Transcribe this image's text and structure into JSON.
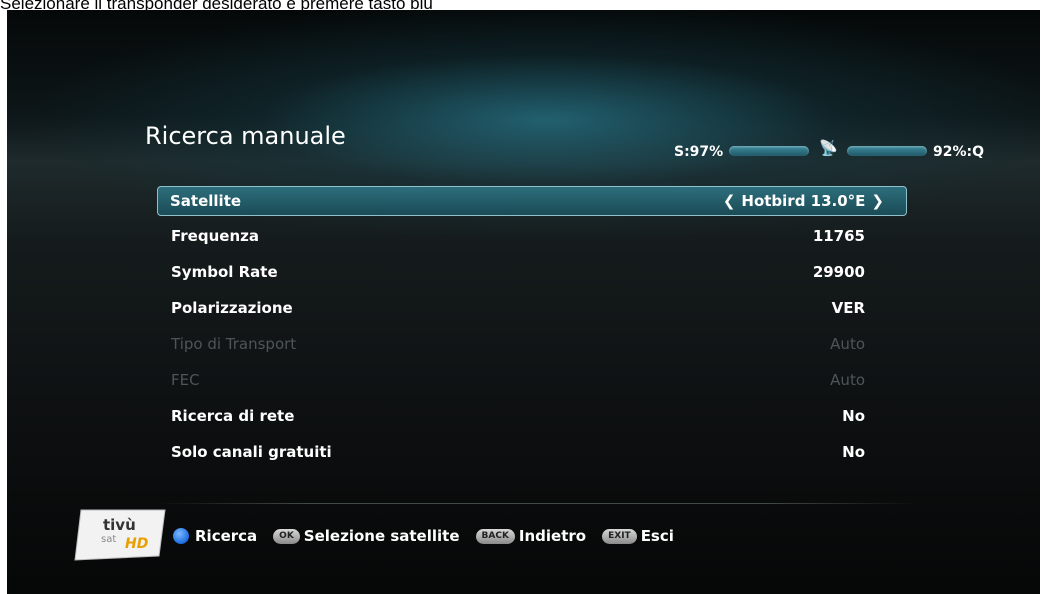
{
  "caption": "Selezionare il transponder desiderato e premere tasto blu",
  "screen": {
    "title": "Ricerca manuale",
    "signal": {
      "strength_label": "S:97%",
      "strength_value": 97,
      "quality_label": "92%:Q",
      "quality_value": 92,
      "icon": "satellite-dish-icon"
    },
    "rows": [
      {
        "label": "Satellite",
        "value": "Hotbird 13.0°E",
        "state": "selected"
      },
      {
        "label": "Frequenza",
        "value": "11765",
        "state": "normal"
      },
      {
        "label": "Symbol Rate",
        "value": "29900",
        "state": "normal"
      },
      {
        "label": "Polarizzazione",
        "value": "VER",
        "state": "normal"
      },
      {
        "label": "Tipo di Transport",
        "value": "Auto",
        "state": "disabled"
      },
      {
        "label": "FEC",
        "value": "Auto",
        "state": "disabled"
      },
      {
        "label": "Ricerca di rete",
        "value": "No",
        "state": "normal"
      },
      {
        "label": "Solo canali gratuiti",
        "value": "No",
        "state": "normal"
      }
    ],
    "chevron_left": "❮",
    "chevron_right": "❯",
    "logo": {
      "line1": "tivù",
      "line2": "sat",
      "line3": "HD"
    },
    "footer": [
      {
        "key": "blue-button",
        "label": "Ricerca"
      },
      {
        "key": "OK",
        "label": "Selezione satellite"
      },
      {
        "key": "BACK",
        "label": "Indietro"
      },
      {
        "key": "EXIT",
        "label": "Esci"
      }
    ],
    "colors": {
      "accent": "#2d6e7c",
      "blue_button": "#1c6de0"
    }
  }
}
